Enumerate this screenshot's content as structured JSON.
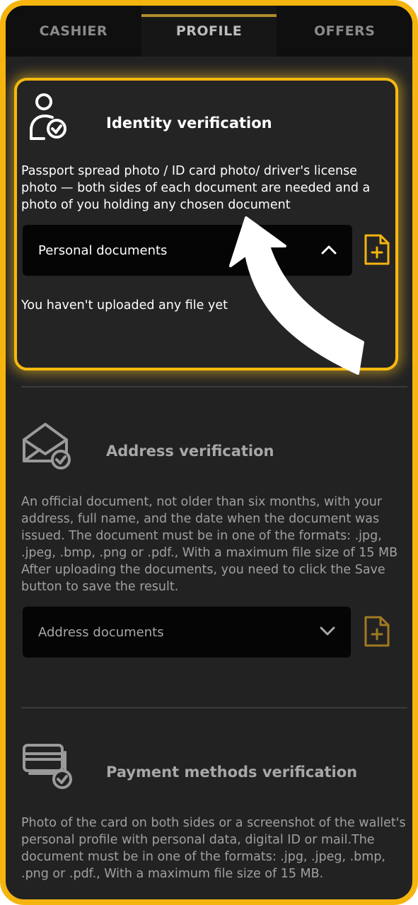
{
  "tabs": [
    {
      "label": "CASHIER",
      "active": false
    },
    {
      "label": "PROFILE",
      "active": true
    },
    {
      "label": "OFFERS",
      "active": false
    }
  ],
  "colors": {
    "accent": "#f5b50e",
    "background": "#222223",
    "dropdown": "#050505"
  },
  "identity": {
    "icon": "user-check-icon",
    "title": "Identity verification",
    "description": "Passport spread photo / ID card photo/ driver's license photo — both sides of each document are needed and a photo of you holding any chosen document",
    "dropdown_label": "Personal documents",
    "dropdown_state": "expanded",
    "upload_icon": "file-plus-icon",
    "empty_message": "You haven't uploaded any file yet"
  },
  "address": {
    "icon": "envelope-check-icon",
    "title": "Address verification",
    "description": "An official document, not older than six months, with your address, full name, and the date when the document was issued. The document must be in one of the formats: .jpg, .jpeg, .bmp, .png or .pdf., With a maximum file size of 15 MB After uploading the documents, you need to click the Save button to save the result.",
    "dropdown_label": "Address documents",
    "dropdown_state": "collapsed",
    "upload_icon": "file-plus-icon"
  },
  "payment": {
    "icon": "cards-check-icon",
    "title": "Payment methods verification",
    "description": "Photo of the card on both sides or a screenshot of the wallet's personal profile with personal data, digital ID or mail.The document must be in one of the formats: .jpg, .jpeg, .bmp, .png or .pdf., With a maximum file size of 15 MB."
  }
}
